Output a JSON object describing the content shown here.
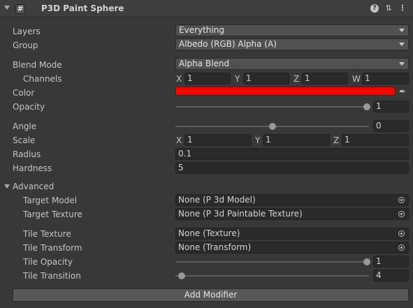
{
  "header": {
    "check_glyph": "#",
    "title": "P3D Paint Sphere",
    "help_glyph": "?",
    "preset_glyph": "⇅",
    "menu_glyph": "⋮"
  },
  "fields": {
    "layers": {
      "label": "Layers",
      "value": "Everything"
    },
    "group": {
      "label": "Group",
      "value": "Albedo (RGB) Alpha (A)"
    },
    "blend_mode": {
      "label": "Blend Mode",
      "value": "Alpha Blend"
    },
    "channels": {
      "label": "Channels",
      "x_label": "X",
      "x": "1",
      "y_label": "Y",
      "y": "1",
      "z_label": "Z",
      "z": "1",
      "w_label": "W",
      "w": "1"
    },
    "color": {
      "label": "Color",
      "value_hex": "#ff0000"
    },
    "opacity": {
      "label": "Opacity",
      "value": "1",
      "slider_fraction": 1.0
    },
    "angle": {
      "label": "Angle",
      "value": "0",
      "slider_fraction": 0.5
    },
    "scale": {
      "label": "Scale",
      "x_label": "X",
      "x": "1",
      "y_label": "Y",
      "y": "1",
      "z_label": "Z",
      "z": "1"
    },
    "radius": {
      "label": "Radius",
      "value": "0.1"
    },
    "hardness": {
      "label": "Hardness",
      "value": "5"
    }
  },
  "advanced": {
    "label": "Advanced",
    "target_model": {
      "label": "Target Model",
      "value": "None (P 3d Model)"
    },
    "target_texture": {
      "label": "Target Texture",
      "value": "None (P 3d Paintable Texture)"
    },
    "tile_texture": {
      "label": "Tile Texture",
      "value": "None (Texture)"
    },
    "tile_transform": {
      "label": "Tile Transform",
      "value": "None (Transform)"
    },
    "tile_opacity": {
      "label": "Tile Opacity",
      "value": "1",
      "slider_fraction": 1.0
    },
    "tile_transition": {
      "label": "Tile Transition",
      "value": "4",
      "slider_fraction": 0.0
    }
  },
  "add_modifier_label": "Add Modifier",
  "colors": {
    "background": "#383838",
    "header": "#3e3e3e",
    "field": "#2a2a2a",
    "dropdown": "#515151",
    "color_swatch": "#ff0000"
  }
}
